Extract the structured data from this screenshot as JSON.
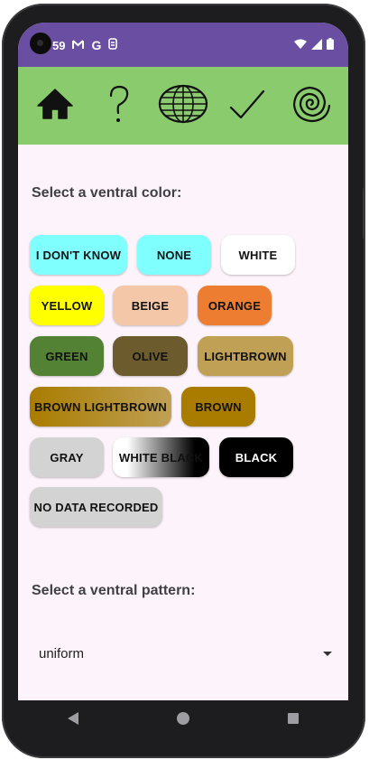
{
  "status": {
    "time": "59",
    "notifications": [
      "gmail-icon",
      "google-icon",
      "data-saver-icon"
    ],
    "system": [
      "wifi-icon",
      "signal-icon",
      "battery-icon"
    ]
  },
  "toolbar": {
    "buttons": [
      "home-icon",
      "help-icon",
      "globe-icon",
      "check-icon",
      "spiral-icon"
    ]
  },
  "ventral_color": {
    "title": "Select a ventral color:",
    "options": [
      {
        "label": "I DON'T KNOW",
        "color": "#80ffff"
      },
      {
        "label": "NONE",
        "color": "#80ffff"
      },
      {
        "label": "WHITE",
        "color": "#ffffff"
      },
      {
        "label": "YELLOW",
        "color": "#ffff00"
      },
      {
        "label": "BEIGE",
        "color": "#f5c7a9"
      },
      {
        "label": "ORANGE",
        "color": "#ed7d31"
      },
      {
        "label": "GREEN",
        "color": "#548235"
      },
      {
        "label": "OLIVE",
        "color": "#6c5b2d"
      },
      {
        "label": "LIGHTBROWN",
        "color": "#bfa055"
      },
      {
        "label": "BROWN LIGHTBROWN",
        "color": "#b08c18"
      },
      {
        "label": "BROWN",
        "color": "#a97c00"
      },
      {
        "label": "GRAY",
        "color": "#d3d3d3"
      },
      {
        "label": "WHITE BLACK",
        "color": "#808080"
      },
      {
        "label": "BLACK",
        "color": "#000000"
      },
      {
        "label": "NO DATA RECORDED",
        "color": "#d3d3d3"
      }
    ]
  },
  "ventral_pattern": {
    "title": "Select a ventral pattern:",
    "selected": "uniform"
  },
  "navbar": {
    "buttons": [
      "back-icon",
      "home-icon",
      "recents-icon"
    ]
  }
}
